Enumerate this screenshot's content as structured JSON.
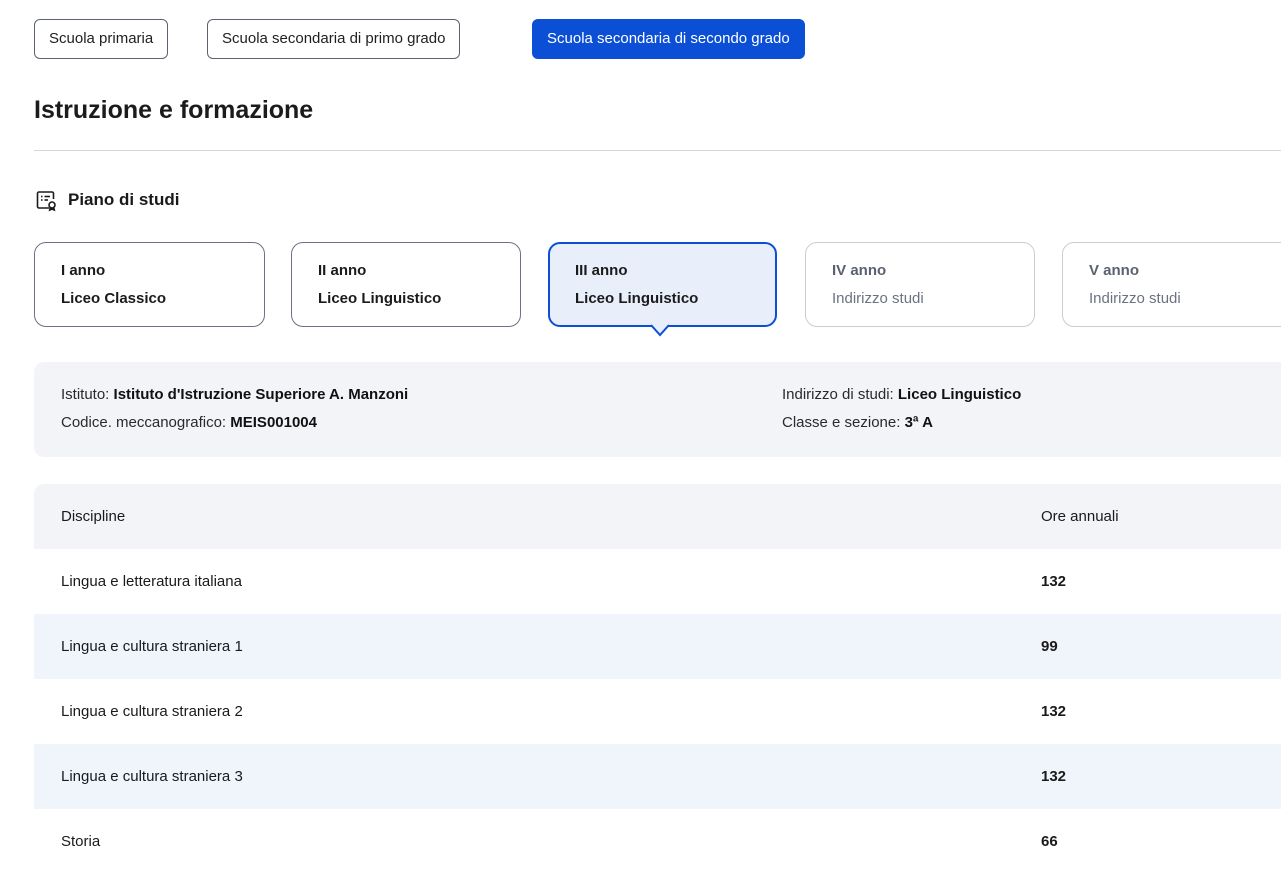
{
  "school_levels": [
    {
      "label": "Scuola primaria"
    },
    {
      "label": "Scuola secondaria di primo grado"
    },
    {
      "label": "Scuola secondaria di secondo grado"
    }
  ],
  "section_title": "Istruzione e formazione",
  "plan": {
    "icon": "study-plan-icon",
    "title": "Piano di studi",
    "years": [
      {
        "year": "I anno",
        "course": "Liceo Classico"
      },
      {
        "year": "II anno",
        "course": "Liceo Linguistico"
      },
      {
        "year": "III anno",
        "course": "Liceo Linguistico"
      },
      {
        "year": "IV anno",
        "course": "Indirizzo studi"
      },
      {
        "year": "V anno",
        "course": "Indirizzo studi"
      }
    ]
  },
  "info": {
    "institute_label": "Istituto:",
    "institute_value": "Istituto d'Istruzione Superiore A. Manzoni",
    "code_label": "Codice. meccanografico:",
    "code_value": "MEIS001004",
    "track_label": "Indirizzo di studi:",
    "track_value": "Liceo Linguistico",
    "class_label": "Classe e sezione:",
    "class_value": "3ª A"
  },
  "table": {
    "headers": [
      "Discipline",
      "Ore annuali"
    ],
    "rows": [
      {
        "subject": "Lingua e letteratura italiana",
        "hours": "132"
      },
      {
        "subject": "Lingua e cultura straniera 1",
        "hours": "99"
      },
      {
        "subject": "Lingua e cultura straniera 2",
        "hours": "132"
      },
      {
        "subject": "Lingua e cultura straniera 3",
        "hours": "132"
      },
      {
        "subject": "Storia",
        "hours": "66"
      }
    ]
  },
  "colors": {
    "accent": "#0a4fd6",
    "active_card_bg": "#e8effb",
    "panel_bg": "#f2f4f7"
  }
}
